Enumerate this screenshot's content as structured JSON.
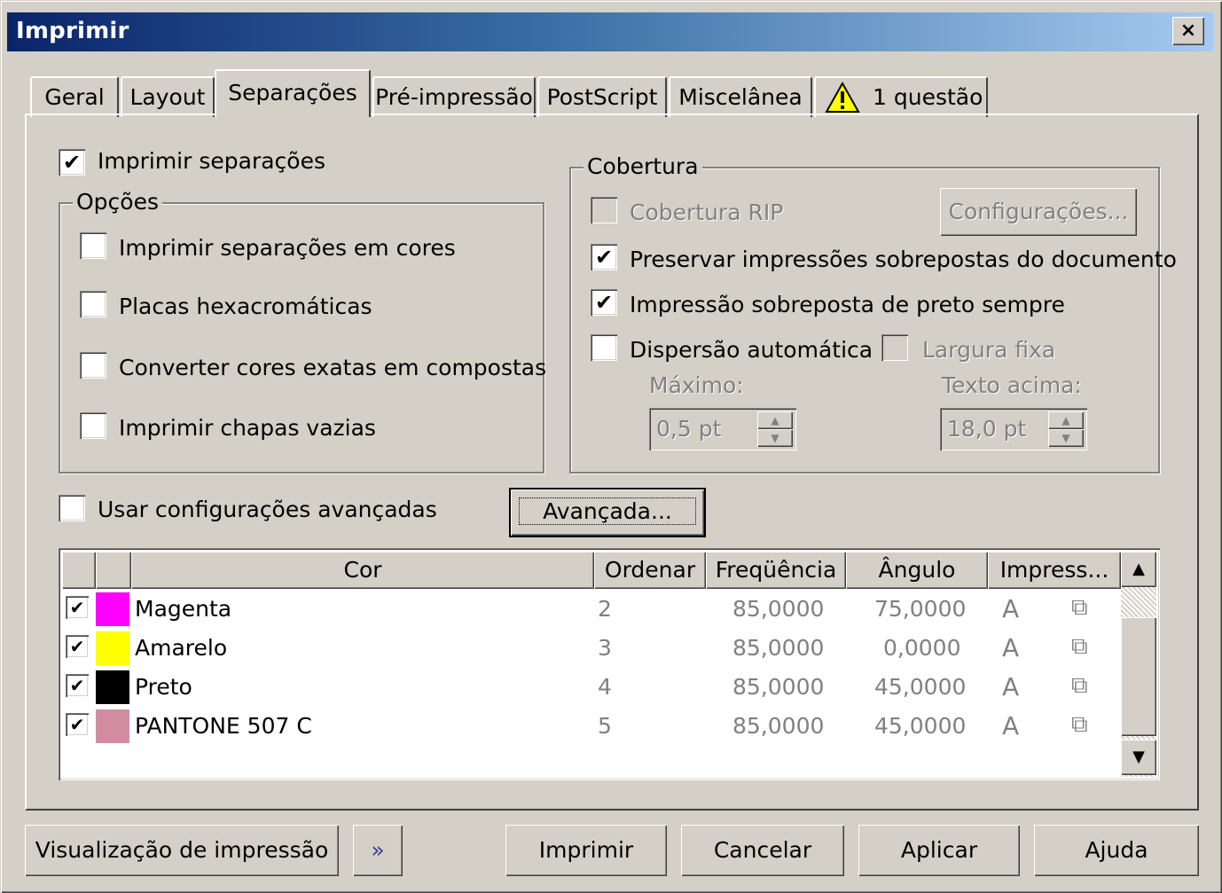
{
  "window": {
    "title": "Imprimir",
    "close_label": "×"
  },
  "tabs": [
    {
      "label": "Geral"
    },
    {
      "label": "Layout"
    },
    {
      "label": "Separações"
    },
    {
      "label": "Pré-impressão"
    },
    {
      "label": "PostScript"
    },
    {
      "label": "Miscelânea"
    },
    {
      "label": "1 questão"
    }
  ],
  "print_separations": {
    "label": "Imprimir separações",
    "checked": true
  },
  "options": {
    "title": "Opções",
    "items": [
      {
        "label": "Imprimir separações em cores",
        "checked": false
      },
      {
        "label": "Placas hexacromáticas",
        "checked": false
      },
      {
        "label": "Converter cores exatas em compostas",
        "checked": false
      },
      {
        "label": "Imprimir chapas vazias",
        "checked": false
      }
    ]
  },
  "coverage": {
    "title": "Cobertura",
    "rip_label": "Cobertura RIP",
    "settings_button": "Configurações...",
    "preserve_label": "Preservar impressões sobrepostas do documento",
    "black_label": "Impressão sobreposta de preto sempre",
    "auto_spread_label": "Dispersão automática",
    "fixed_width_label": "Largura fixa",
    "max_label": "Máximo:",
    "max_value": "0,5 pt",
    "text_above_label": "Texto acima:",
    "text_above_value": "18,0 pt"
  },
  "advanced": {
    "use_label": "Usar configurações avançadas",
    "button_label": "Avançada..."
  },
  "color_table": {
    "headers": [
      "Cor",
      "Ordenar",
      "Freqüência",
      "Ângulo",
      "Impress..."
    ],
    "rows": [
      {
        "name": "Magenta",
        "color": "#ff00ff",
        "order": "2",
        "frequency": "85,0000",
        "angle": "75,0000"
      },
      {
        "name": "Amarelo",
        "color": "#ffff00",
        "order": "3",
        "frequency": "85,0000",
        "angle": "0,0000"
      },
      {
        "name": "Preto",
        "color": "#000000",
        "order": "4",
        "frequency": "85,0000",
        "angle": "45,0000"
      },
      {
        "name": "PANTONE 507 C",
        "color": "#d28ca0",
        "order": "5",
        "frequency": "85,0000",
        "angle": "45,0000"
      }
    ]
  },
  "footer": {
    "preview": "Visualização de impressão",
    "print": "Imprimir",
    "cancel": "Cancelar",
    "apply": "Aplicar",
    "help": "Ajuda"
  }
}
